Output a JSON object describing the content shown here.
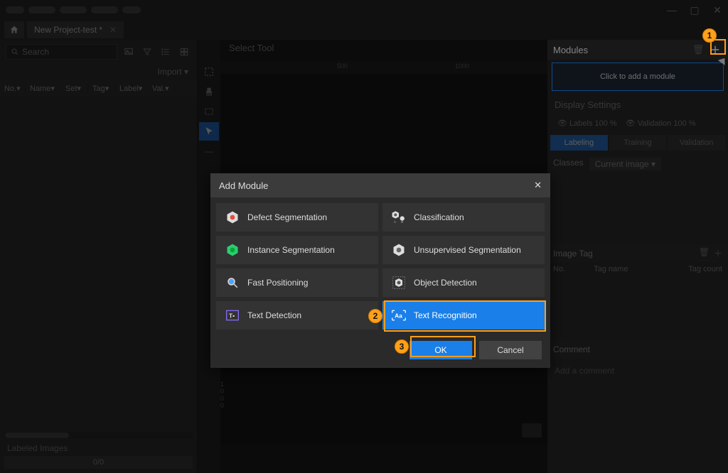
{
  "titlebar": {},
  "project_tab": {
    "title": "New Project-test *"
  },
  "left": {
    "search_placeholder": "Search",
    "import_label": "Import ▾",
    "headers": {
      "no": "No.▾",
      "name": "Name▾",
      "set": "Set▾",
      "tag": "Tag▾",
      "label": "Label▾",
      "val": "Val.▾"
    },
    "labeled_images": "Labeled Images",
    "progress": "0/0"
  },
  "center": {
    "select_tool": "Select Tool",
    "ruler_marks": {
      "m500": "500",
      "m1000": "1000"
    },
    "ruler_v": {
      "r1": "1",
      "r0a": "0",
      "r0b": "0",
      "r0c": "0"
    }
  },
  "right": {
    "modules_title": "Modules",
    "add_module_hint": "Click to add a module",
    "display_settings": "Display Settings",
    "labels": "Labels",
    "labels_pct": "100 %",
    "validation": "Validation",
    "validation_pct": "100 %",
    "tabs": {
      "labeling": "Labeling",
      "training": "Training",
      "validation": "Validation"
    },
    "classes": "Classes",
    "current_image": "Current image ▾",
    "image_tag": "Image Tag",
    "tag_cols": {
      "no": "No.",
      "name": "Tag name",
      "count": "Tag count"
    },
    "comment_title": "Comment",
    "comment_placeholder": "Add a comment"
  },
  "modal": {
    "title": "Add Module",
    "options": {
      "defect_seg": "Defect Segmentation",
      "classification": "Classification",
      "instance_seg": "Instance Segmentation",
      "unsup_seg": "Unsupervised Segmentation",
      "fast_pos": "Fast Positioning",
      "obj_det": "Object Detection",
      "text_det": "Text Detection",
      "text_rec": "Text Recognition"
    },
    "ok": "OK",
    "cancel": "Cancel"
  },
  "callouts": {
    "c1": "1",
    "c2": "2",
    "c3": "3"
  }
}
